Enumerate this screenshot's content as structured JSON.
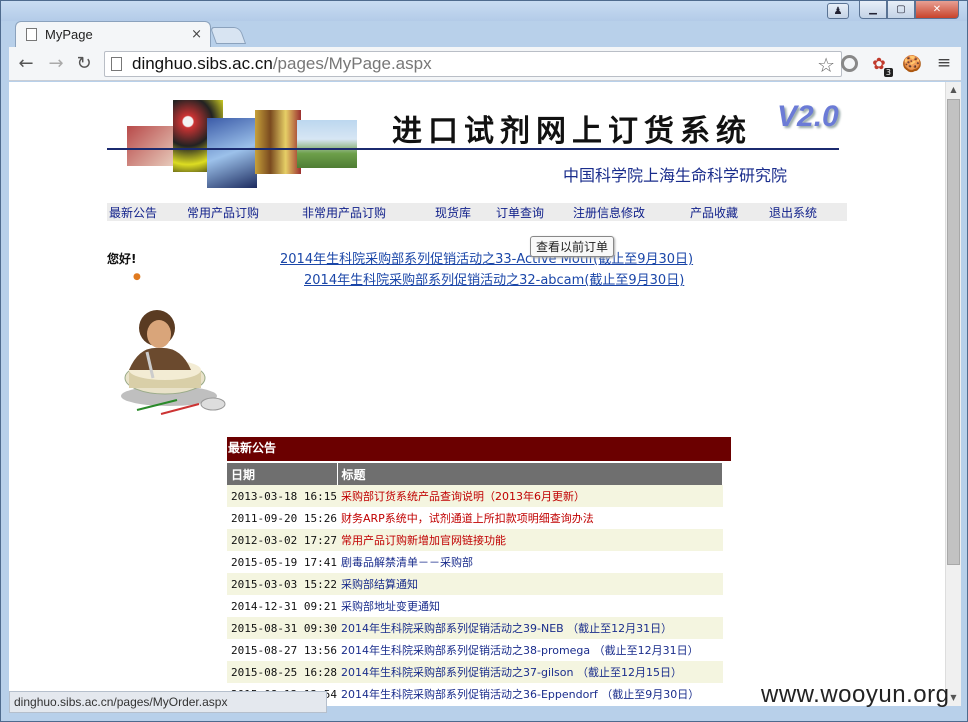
{
  "browser": {
    "tab_title": "MyPage",
    "url_host": "dinghuo.sibs.ac.cn",
    "url_path": "/pages/MyPage.aspx",
    "extension_badge": "3",
    "status_url": "dinghuo.sibs.ac.cn/pages/MyOrder.aspx",
    "close_glyph": "✕",
    "tab_close_glyph": "×"
  },
  "header": {
    "system_title": "进口试剂网上订货系统",
    "version": "V2.0",
    "institute": "中国科学院上海生命科学研究院"
  },
  "nav": {
    "items": [
      "最新公告",
      "常用产品订购",
      "非常用产品订购",
      "现货库",
      "订单查询",
      "注册信息修改",
      "产品收藏",
      "退出系统"
    ]
  },
  "tooltip": "查看以前订单",
  "greeting": "您好!",
  "promos": [
    "2014年生科院采购部系列促销活动之33-Active Motif(截止至9月30日)",
    "2014年生科院采购部系列促销活动之32-abcam(截止至9月30日)"
  ],
  "notice": {
    "heading": "最新公告",
    "col_date": "日期",
    "col_title": "标题",
    "rows": [
      {
        "date": "2013-03-18 16:15",
        "title": "采购部订货系统产品查询说明（2013年6月更新）",
        "color": "red"
      },
      {
        "date": "2011-09-20 15:26",
        "title": "财务ARP系统中，试剂通道上所扣款项明细查询办法",
        "color": "red"
      },
      {
        "date": "2012-03-02 17:27",
        "title": "常用产品订购新增加官网链接功能",
        "color": "red"
      },
      {
        "date": "2015-05-19 17:41",
        "title": "剧毒品解禁清单－－采购部",
        "color": "blue"
      },
      {
        "date": "2015-03-03 15:22",
        "title": "采购部结算通知",
        "color": "blue"
      },
      {
        "date": "2014-12-31 09:21",
        "title": "采购部地址变更通知",
        "color": "blue"
      },
      {
        "date": "2015-08-31 09:30",
        "title": "2014年生科院采购部系列促销活动之39-NEB （截止至12月31日）",
        "color": "blue"
      },
      {
        "date": "2015-08-27 13:56",
        "title": "2014年生科院采购部系列促销活动之38-promega （截止至12月31日）",
        "color": "blue"
      },
      {
        "date": "2015-08-25 16:28",
        "title": "2014年生科院采购部系列促销活动之37-gilson （截止至12月15日）",
        "color": "blue"
      },
      {
        "date": "2015-08-13 13:54",
        "title": "2014年生科院采购部系列促销活动之36-Eppendorf （截止至9月30日）",
        "color": "blue"
      }
    ]
  },
  "watermark": "www.wooyun.org"
}
